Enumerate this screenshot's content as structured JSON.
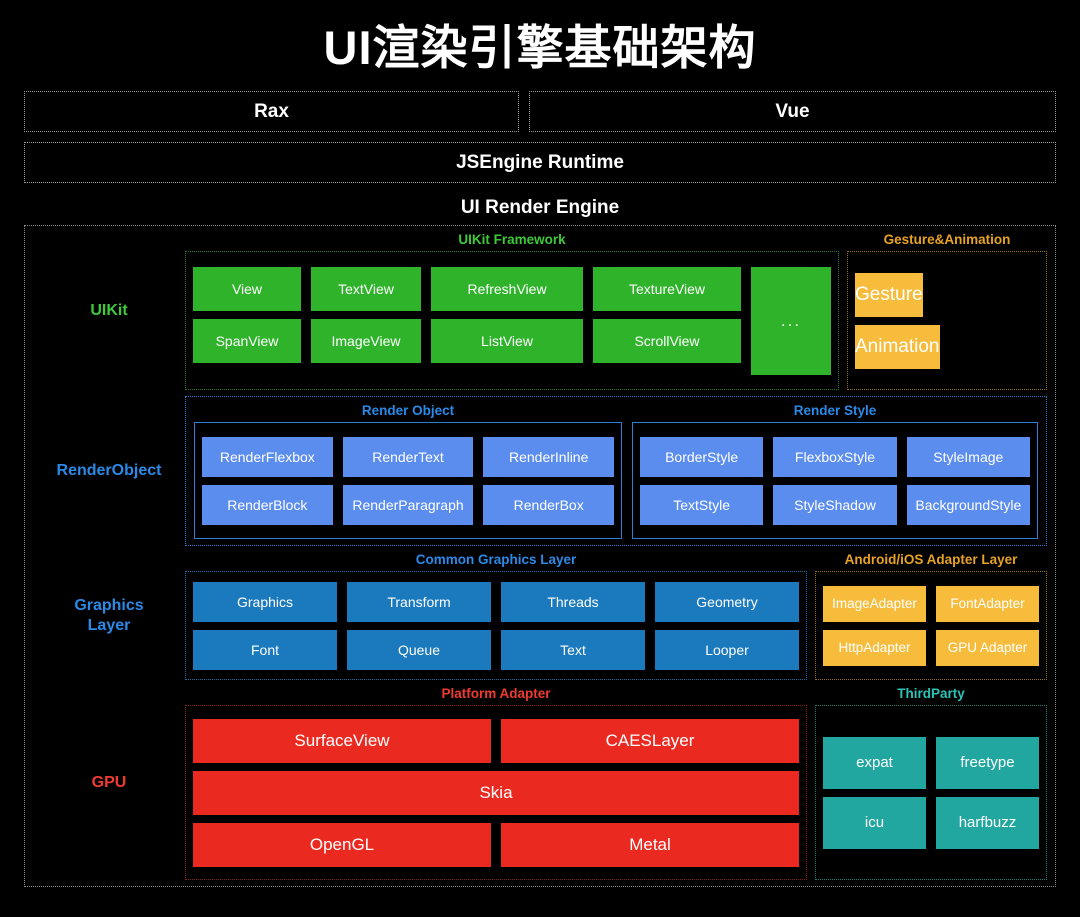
{
  "title": "UI渲染引擎基础架构",
  "top": {
    "frameworks": [
      {
        "label": "Rax"
      },
      {
        "label": "Vue"
      }
    ],
    "runtime": "JSEngine Runtime"
  },
  "engine": {
    "title": "UI Render Engine",
    "layers": [
      {
        "label": "UIKit",
        "label_color": "#3ec93a",
        "groups": [
          {
            "title": "UIKit Framework",
            "title_color": "#3ec93a",
            "border_color": "#2b7a25",
            "fill": "#2fb32b",
            "rows": [
              [
                "View",
                "TextView",
                "RefreshView",
                "TextureView"
              ],
              [
                "SpanView",
                "ImageView",
                "ListView",
                "ScrollView"
              ]
            ],
            "ellipsis": "..."
          },
          {
            "title": "Gesture&Animation",
            "title_color": "#e8a325",
            "border_color": "#9a7316",
            "fill": "#f7bc3b",
            "rows": [
              [
                "Gesture"
              ],
              [
                "Animation"
              ]
            ]
          }
        ]
      },
      {
        "label": "RenderObject",
        "label_color": "#2b8ae8",
        "groups": [
          {
            "title": "Render Object",
            "title_color": "#2b8ae8",
            "border_color": "#2b7fd4",
            "fill": "#5b8def",
            "rows": [
              [
                "RenderFlexbox",
                "RenderText",
                "RenderInline"
              ],
              [
                "RenderBlock",
                "RenderParagraph",
                "RenderBox"
              ]
            ]
          },
          {
            "title": "Render Style",
            "title_color": "#2b8ae8",
            "border_color": "#2b7fd4",
            "fill": "#5b8def",
            "rows": [
              [
                "BorderStyle",
                "FlexboxStyle",
                "StyleImage"
              ],
              [
                "TextStyle",
                "StyleShadow",
                "BackgroundStyle"
              ]
            ]
          }
        ]
      },
      {
        "label": "Graphics\nLayer",
        "label_line1": "Graphics",
        "label_line2": "Layer",
        "label_color": "#2b8ae8",
        "groups": [
          {
            "title": "Common Graphics Layer",
            "title_color": "#2b8ae8",
            "border_color": "#1b6fa8",
            "fill": "#1b79bd",
            "rows": [
              [
                "Graphics",
                "Transform",
                "Threads",
                "Geometry"
              ],
              [
                "Font",
                "Queue",
                "Text",
                "Looper"
              ]
            ]
          },
          {
            "title": "Android/iOS Adapter Layer",
            "title_color": "#e8a325",
            "border_color": "#9a7316",
            "fill": "#f7bc3b",
            "rows": [
              [
                "ImageAdapter",
                "FontAdapter"
              ],
              [
                "HttpAdapter",
                "GPU Adapter"
              ]
            ]
          }
        ]
      },
      {
        "label": "GPU",
        "label_color": "#ef3b31",
        "groups": [
          {
            "title": "Platform Adapter",
            "title_color": "#ef3b31",
            "border_color": "#8c231c",
            "fill": "#ea2a20",
            "rows": [
              [
                "SurfaceView",
                "CAESLayer"
              ],
              [
                "Skia"
              ],
              [
                "OpenGL",
                "Metal"
              ]
            ]
          },
          {
            "title": "ThirdParty",
            "title_color": "#2dc2b7",
            "border_color": "#1b8179",
            "fill": "#21a79f",
            "rows": [
              [
                "expat",
                "freetype"
              ],
              [
                "icu",
                "harfbuzz"
              ]
            ]
          }
        ]
      }
    ]
  },
  "colors": {
    "background": "#000000",
    "green": "#2fb32b",
    "light_blue": "#5b8def",
    "dark_blue": "#1b79bd",
    "amber": "#f7bc3b",
    "red": "#ea2a20",
    "teal": "#21a79f",
    "dotted_border": "#9a9a9a"
  }
}
